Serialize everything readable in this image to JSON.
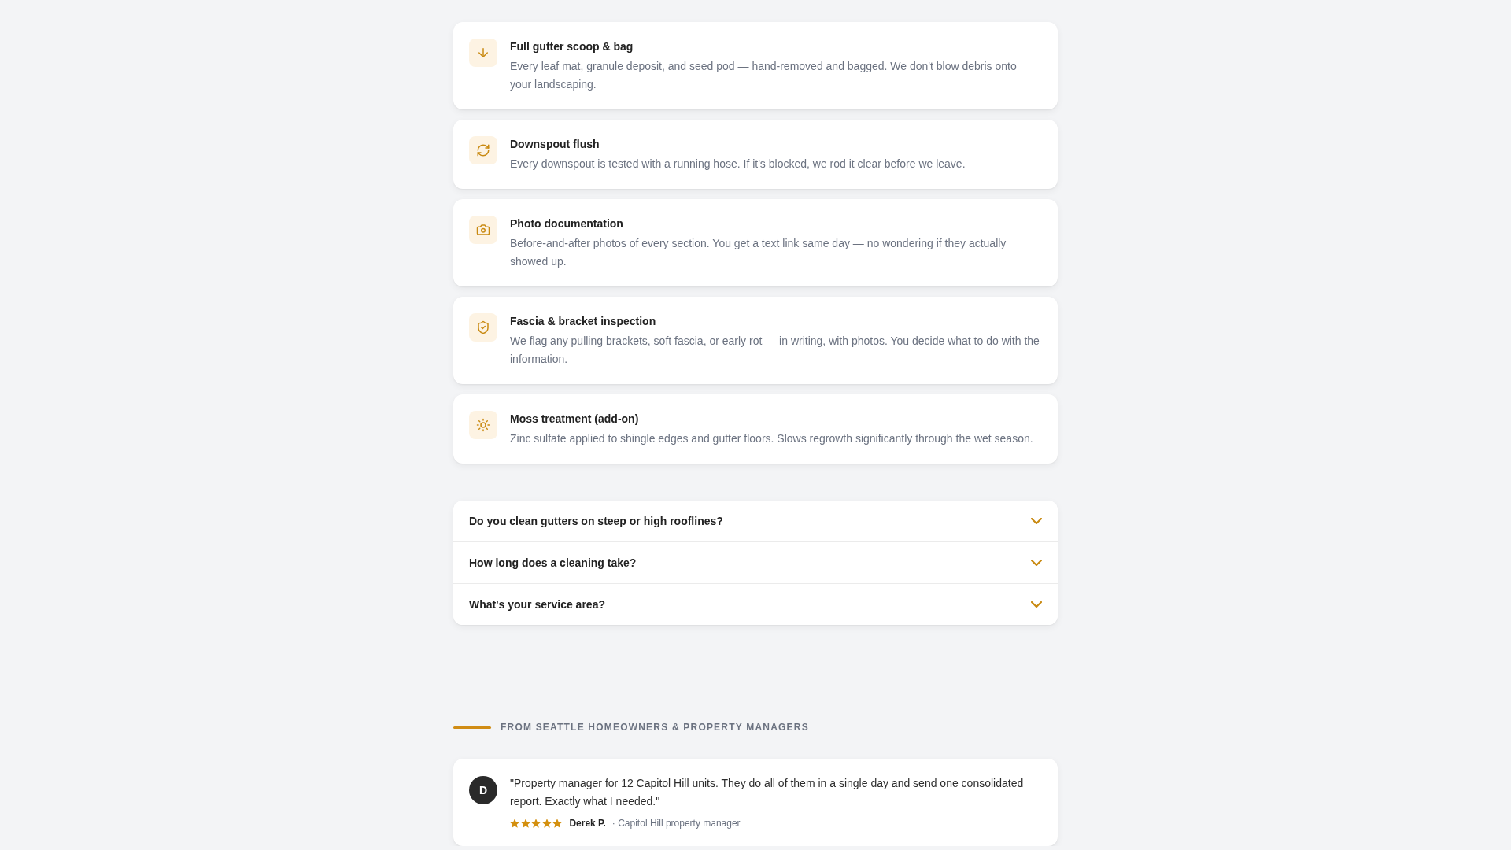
{
  "services": [
    {
      "title": "Full gutter scoop & bag",
      "description": "Every leaf mat, granule deposit, and seed pod — hand-removed and bagged. We don't blow debris onto your landscaping."
    },
    {
      "title": "Downspout flush",
      "description": "Every downspout is tested with a running hose. If it's blocked, we rod it clear before we leave."
    },
    {
      "title": "Photo documentation",
      "description": "Before-and-after photos of every section. You get a text link same day — no wondering if they actually showed up."
    },
    {
      "title": "Fascia & bracket inspection",
      "description": "We flag any pulling brackets, soft fascia, or early rot — in writing, with photos. You decide what to do with the information."
    },
    {
      "title": "Moss treatment (add-on)",
      "description": "Zinc sulfate applied to shingle edges and gutter floors. Slows regrowth significantly through the wet season."
    }
  ],
  "faq": [
    {
      "question": "Do you clean gutters on steep or high rooflines?",
      "expanded": false
    },
    {
      "question": "How long does a cleaning take?",
      "expanded": false
    },
    {
      "question": "What's your service area?",
      "expanded": false
    }
  ],
  "testimonials": {
    "heading": "FROM SEATTLE HOMEOWNERS & PROPERTY MANAGERS",
    "items": [
      {
        "initial": "D",
        "quote": "\"Property manager for 12 Capitol Hill units. They do all of them in a single day and send one consolidated report. Exactly what I needed.\"",
        "stars": 5,
        "name": "Derek P.",
        "role": "· Capitol Hill property manager"
      }
    ]
  }
}
